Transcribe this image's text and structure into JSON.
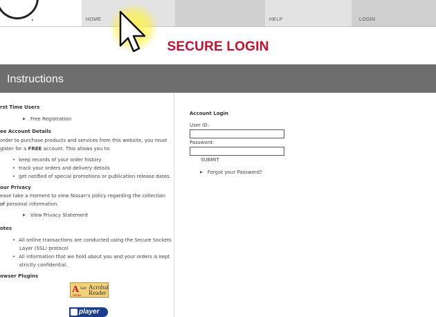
{
  "nav": {
    "home": "HOME",
    "help": "HELP",
    "login": "LOGIN"
  },
  "page_title": "SECURE LOGIN",
  "instructions_heading": "Instructions",
  "left": {
    "first_time_heading": "rst Time Users",
    "free_registration": "Free Registration",
    "account_details_heading": "ee Account Details",
    "account_details_text_1": "order to purchase products and services from this website, you must",
    "account_details_text_2": "gister for a",
    "account_details_free": "FREE",
    "account_details_text_3": "account. This allows you to:",
    "benefits": [
      "keep records of your order history",
      "track your orders and delivery details",
      "get notified of special promotions or publication release dates."
    ],
    "privacy_heading": "our Privacy",
    "privacy_text_1": "ease take a moment to view Nissan's policy regarding the collection of",
    "privacy_text_2": "ur personal information.",
    "privacy_link": "View Privacy Statement",
    "notes_heading": "otes",
    "notes": [
      "All online transactions are conducted using the Secure Sockets",
      "Layer (SSL) protocol",
      "All information that we hold about you and your orders is kept",
      "strictly confidential."
    ],
    "plugins_heading": "owser Plugins",
    "acrobat_get": "Get",
    "acrobat_name_1": "Acrobat",
    "acrobat_name_2": "Reader",
    "acrobat_vendor": "Adobe",
    "realplayer": "player"
  },
  "login": {
    "title": "Account Login",
    "userid_label": "User ID:",
    "userid_value": "",
    "password_label": "Password:",
    "password_value": "",
    "submit": "SUBMIT",
    "forgot": "Forgot your Password?"
  },
  "colors": {
    "title_red": "#c8102e",
    "band_gray": "#6e6e6e",
    "cursor_highlight": "#fff34f"
  },
  "icons": {
    "cursor": "arrow-pointer-icon",
    "logo": "brand-logo-icon",
    "arrow_bullet": "triangle-right-icon"
  }
}
